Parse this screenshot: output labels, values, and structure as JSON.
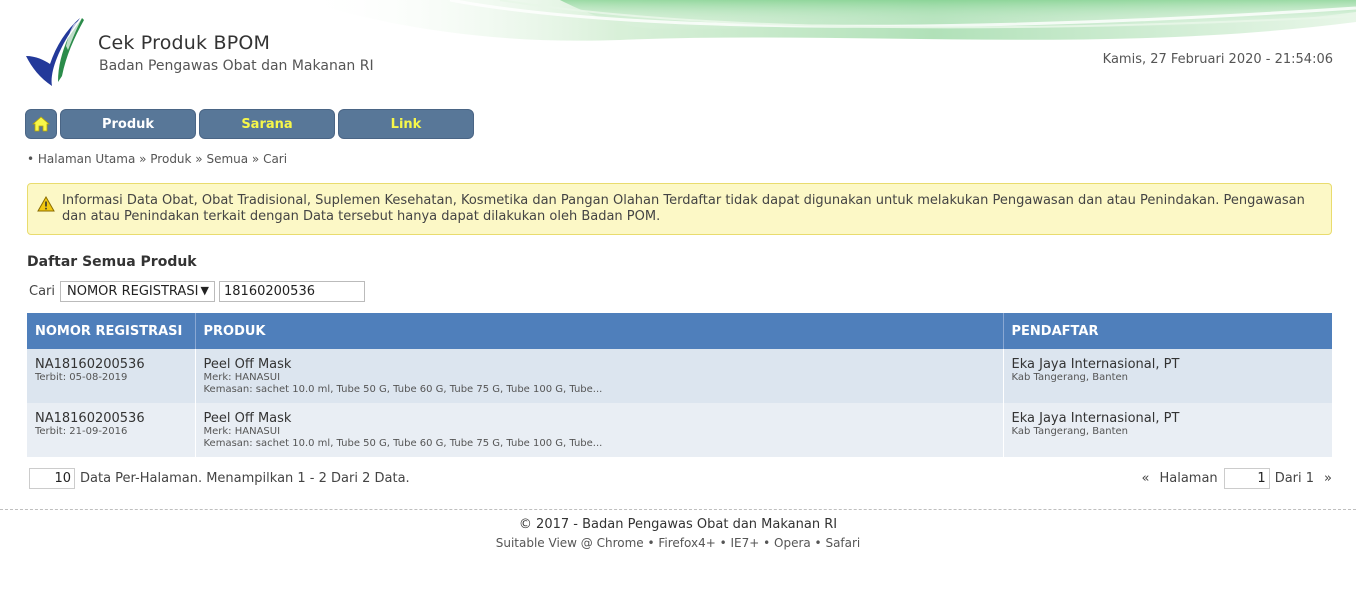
{
  "header": {
    "title": "Cek Produk BPOM",
    "subtitle": "Badan Pengawas Obat dan Makanan RI",
    "datetime": "Kamis, 27 Februari 2020 - 21:54:06",
    "logo_icon": "bpom-logo-icon"
  },
  "nav": {
    "home_icon": "home-icon",
    "items": [
      {
        "label": "Produk"
      },
      {
        "label": "Sarana"
      },
      {
        "label": "Link"
      }
    ],
    "color": "#587798",
    "highlight_color": "#f7f74a"
  },
  "breadcrumb": "• Halaman Utama » Produk » Semua » Cari",
  "alert": {
    "icon": "warning-icon",
    "text": "Informasi Data Obat, Obat Tradisional, Suplemen Kesehatan, Kosmetika dan Pangan Olahan Terdaftar tidak dapat digunakan untuk melakukan Pengawasan dan atau Penindakan. Pengawasan dan atau Penindakan terkait dengan Data tersebut hanya dapat dilakukan oleh Badan POM."
  },
  "section_title": "Daftar Semua Produk",
  "search": {
    "label": "Cari",
    "field_selected": "NOMOR REGISTRASI",
    "value": "18160200536"
  },
  "table": {
    "header_color": "#4f7fbb",
    "columns": [
      "NOMOR REGISTRASI",
      "PRODUK",
      "PENDAFTAR"
    ],
    "rows": [
      {
        "reg_no": "NA18160200536",
        "issued": "Terbit: 05-08-2019",
        "product": "Peel Off Mask",
        "brand": "Merk: HANASUI",
        "packaging": "Kemasan: sachet 10.0 ml, Tube 50 G, Tube 60 G, Tube 75 G, Tube 100 G, Tube...",
        "registrant": "Eka Jaya Internasional, PT",
        "location": "Kab Tangerang, Banten"
      },
      {
        "reg_no": "NA18160200536",
        "issued": "Terbit: 21-09-2016",
        "product": "Peel Off Mask",
        "brand": "Merk: HANASUI",
        "packaging": "Kemasan: sachet 10.0 ml, Tube 50 G, Tube 60 G, Tube 75 G, Tube 100 G, Tube...",
        "registrant": "Eka Jaya Internasional, PT",
        "location": "Kab Tangerang, Banten"
      }
    ]
  },
  "pagination": {
    "per_page": "10",
    "summary": "Data Per-Halaman. Menampilkan 1 - 2 Dari 2 Data.",
    "prev": "«",
    "page_label": "Halaman",
    "page": "1",
    "of_label": "Dari 1",
    "next": "»"
  },
  "footer": {
    "copyright": "© 2017 - Badan Pengawas Obat dan Makanan RI",
    "browsers": "Suitable View @ Chrome • Firefox4+ • IE7+ • Opera • Safari"
  }
}
